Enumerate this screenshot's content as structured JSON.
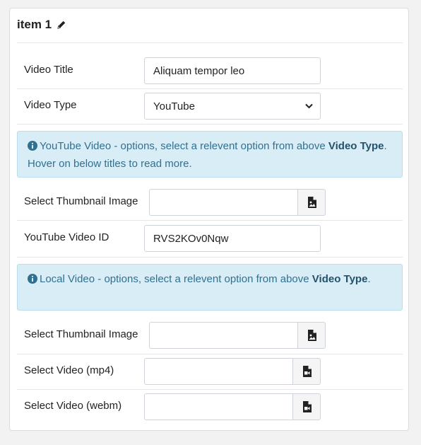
{
  "panel": {
    "title": "item 1"
  },
  "fields": {
    "video_title": {
      "label": "Video Title",
      "value": "Aliquam tempor leo"
    },
    "video_type": {
      "label": "Video Type",
      "selected": "YouTube"
    },
    "youtube_thumb": {
      "label": "Select Thumbnail Image",
      "value": ""
    },
    "youtube_id": {
      "label": "YouTube Video ID",
      "value": "RVS2KOv0Nqw"
    },
    "local_thumb": {
      "label": "Select Thumbnail Image",
      "value": ""
    },
    "mp4": {
      "label": "Select Video (mp4)",
      "value": ""
    },
    "webm": {
      "label": "Select Video (webm)",
      "value": ""
    }
  },
  "alerts": {
    "youtube": {
      "prefix": "YouTube Video - options, select a relevent option from above ",
      "bold": "Video Type",
      "suffix": ". Hover on below titles to read more."
    },
    "local": {
      "prefix": "Local Video - options, select a relevent option from above ",
      "bold": "Video Type",
      "suffix": "."
    }
  },
  "icons": {
    "edit": "pencil-icon",
    "info": "info-circle-icon",
    "image_picker": "image-file-icon",
    "video_picker": "video-file-icon",
    "dropdown": "chevron-down-icon"
  },
  "colors": {
    "alert_bg": "#d9edf7",
    "alert_text": "#31708f",
    "border": "#ced4da"
  }
}
